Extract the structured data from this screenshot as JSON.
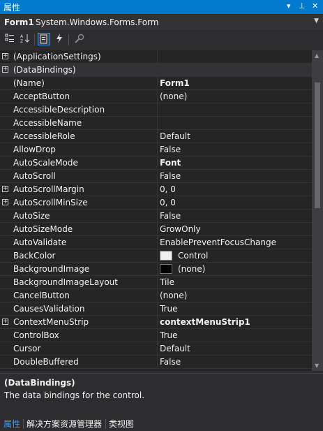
{
  "title": {
    "label": "属性",
    "controls": [
      "▾",
      "⊥",
      "✕"
    ]
  },
  "object_selector": {
    "name": "Form1",
    "type": "System.Windows.Forms.Form"
  },
  "toolbar": {
    "categorized_icon": "categorized-icon",
    "alphabetical_icon": "alphabetical-icon",
    "properties_icon": "properties-icon",
    "events_icon": "events-icon",
    "property_pages_icon": "property-pages-icon"
  },
  "rows": [
    {
      "name": "(ApplicationSettings)",
      "value": "",
      "expandable": true
    },
    {
      "name": "(DataBindings)",
      "value": "",
      "expandable": true,
      "selected": true
    },
    {
      "name": "(Name)",
      "value": "Form1",
      "bold": true
    },
    {
      "name": "AcceptButton",
      "value": "(none)"
    },
    {
      "name": "AccessibleDescription",
      "value": ""
    },
    {
      "name": "AccessibleName",
      "value": ""
    },
    {
      "name": "AccessibleRole",
      "value": "Default"
    },
    {
      "name": "AllowDrop",
      "value": "False"
    },
    {
      "name": "AutoScaleMode",
      "value": "Font",
      "bold": true
    },
    {
      "name": "AutoScroll",
      "value": "False"
    },
    {
      "name": "AutoScrollMargin",
      "value": "0, 0",
      "expandable": true
    },
    {
      "name": "AutoScrollMinSize",
      "value": "0, 0",
      "expandable": true
    },
    {
      "name": "AutoSize",
      "value": "False"
    },
    {
      "name": "AutoSizeMode",
      "value": "GrowOnly"
    },
    {
      "name": "AutoValidate",
      "value": "EnablePreventFocusChange"
    },
    {
      "name": "BackColor",
      "value": "Control",
      "swatch": "#f0f0f0"
    },
    {
      "name": "BackgroundImage",
      "value": "(none)",
      "swatch": "#000000"
    },
    {
      "name": "BackgroundImageLayout",
      "value": "Tile"
    },
    {
      "name": "CancelButton",
      "value": "(none)"
    },
    {
      "name": "CausesValidation",
      "value": "True"
    },
    {
      "name": "ContextMenuStrip",
      "value": "contextMenuStrip1",
      "bold": true,
      "expandable": true
    },
    {
      "name": "ControlBox",
      "value": "True"
    },
    {
      "name": "Cursor",
      "value": "Default"
    },
    {
      "name": "DoubleBuffered",
      "value": "False"
    }
  ],
  "description": {
    "heading": "(DataBindings)",
    "body": "The data bindings for the control."
  },
  "tabs": [
    "属性",
    "解决方案资源管理器",
    "类视图"
  ],
  "colors": {
    "accent": "#007acc",
    "active_tab": "#3399ff",
    "background": "#252526"
  }
}
